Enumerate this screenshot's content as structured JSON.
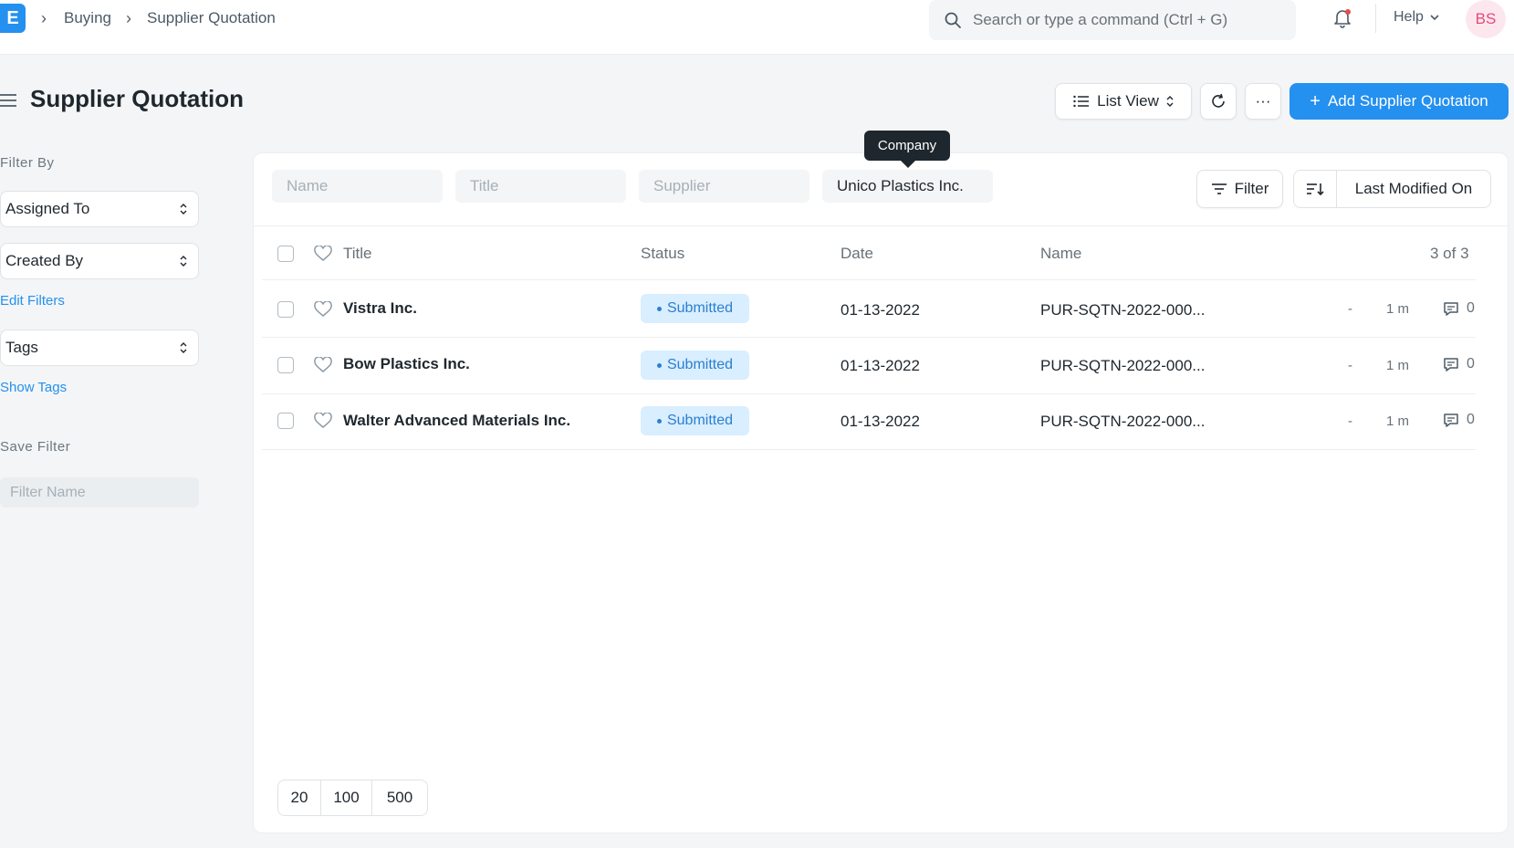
{
  "navbar": {
    "logo": "E",
    "breadcrumbs": [
      "Buying",
      "Supplier Quotation"
    ],
    "search_placeholder": "Search or type a command (Ctrl + G)",
    "help_label": "Help",
    "avatar_initials": "BS"
  },
  "page": {
    "title": "Supplier Quotation",
    "list_view_label": "List View",
    "more_label": "···",
    "add_button_label": "Add Supplier Quotation"
  },
  "sidebar": {
    "filter_by_label": "Filter By",
    "assigned_to_label": "Assigned To",
    "created_by_label": "Created By",
    "edit_filters_label": "Edit Filters",
    "tags_label": "Tags",
    "show_tags_label": "Show Tags",
    "save_filter_label": "Save Filter",
    "filter_name_placeholder": "Filter Name"
  },
  "filters": {
    "name_placeholder": "Name",
    "title_placeholder": "Title",
    "supplier_placeholder": "Supplier",
    "company_value": "Unico Plastics Inc.",
    "company_tooltip": "Company",
    "filter_button_label": "Filter",
    "sort_field_label": "Last Modified On"
  },
  "table": {
    "columns": {
      "title": "Title",
      "status": "Status",
      "date": "Date",
      "name": "Name"
    },
    "count_label": "3 of 3",
    "rows": [
      {
        "title": "Vistra Inc.",
        "status": "Submitted",
        "date": "01-13-2022",
        "name": "PUR-SQTN-2022-000...",
        "assigned": "-",
        "modified": "1 m",
        "comments": "0"
      },
      {
        "title": "Bow Plastics Inc.",
        "status": "Submitted",
        "date": "01-13-2022",
        "name": "PUR-SQTN-2022-000...",
        "assigned": "-",
        "modified": "1 m",
        "comments": "0"
      },
      {
        "title": "Walter Advanced Materials Inc.",
        "status": "Submitted",
        "date": "01-13-2022",
        "name": "PUR-SQTN-2022-000...",
        "assigned": "-",
        "modified": "1 m",
        "comments": "0"
      }
    ]
  },
  "paging": {
    "options": [
      "20",
      "100",
      "500"
    ]
  },
  "colors": {
    "primary": "#2490ef",
    "badge_bg": "#d9eeff",
    "badge_text": "#2b7fd0"
  }
}
